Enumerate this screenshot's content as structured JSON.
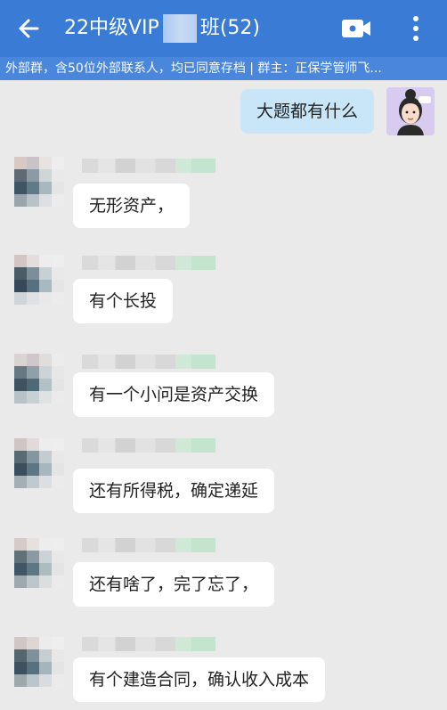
{
  "header": {
    "title_prefix": "22中级VIP",
    "title_suffix": "班(52)",
    "notice": "外部群，含50位外部联系人，均已同意存档 | 群主：正保学管师飞..."
  },
  "my_message": {
    "text": "大题都有什么"
  },
  "messages": [
    {
      "text": "无形资产，"
    },
    {
      "text": "有个长投"
    },
    {
      "text": "有一个小问是资产交换"
    },
    {
      "text": "还有所得税，确定递延"
    },
    {
      "text": "还有啥了，完了忘了，"
    },
    {
      "text": "有个建造合同，确认收入成本"
    }
  ],
  "colors": {
    "header_bg": "#3a7bd5",
    "notice_bg": "#4a86dc",
    "my_bubble": "#c9e6f8",
    "chat_bg": "#eaeaea"
  },
  "icons": {
    "back": "arrow-left-icon",
    "video": "video-call-icon",
    "more": "more-vertical-icon"
  }
}
